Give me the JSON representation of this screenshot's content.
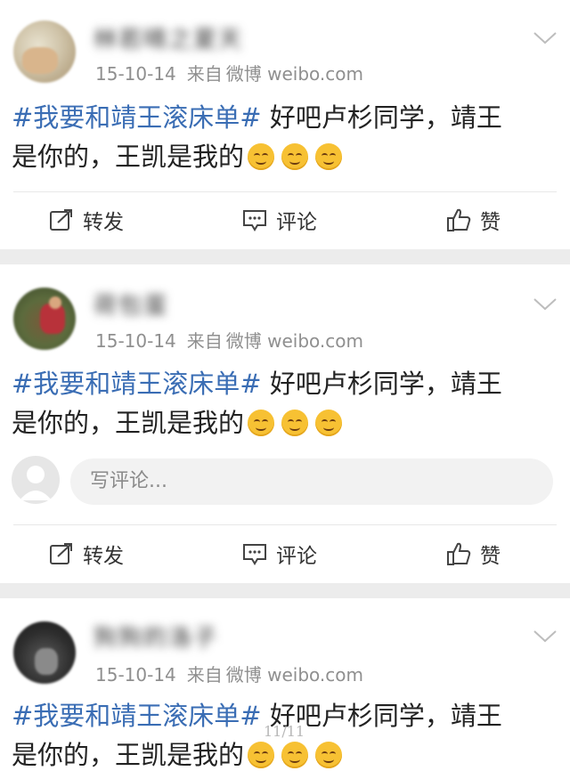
{
  "posts": [
    {
      "username": "林若晴之夏天",
      "date": "15-10-14",
      "source_prefix": "来自",
      "source": "微博 weibo.com",
      "topic": "#我要和靖王滚床单#",
      "text_line1": " 好吧卢杉同学，靖王",
      "text_line2": "是你的，王凯是我的",
      "emoji": "smile-emoji",
      "repost_label": "转发",
      "comment_label": "评论",
      "like_label": "赞"
    },
    {
      "username": "荷包蛋",
      "date": "15-10-14",
      "source_prefix": "来自",
      "source": "微博 weibo.com",
      "topic": "#我要和靖王滚床单#",
      "text_line1": " 好吧卢杉同学，靖王",
      "text_line2": "是你的，王凯是我的",
      "comment_placeholder": "写评论...",
      "repost_label": "转发",
      "comment_label": "评论",
      "like_label": "赞"
    },
    {
      "username": "狗狗的洛子",
      "date": "15-10-14",
      "source_prefix": "来自",
      "source": "微博 weibo.com",
      "topic": "#我要和靖王滚床单#",
      "text_line1": " 好吧卢杉同学，靖王",
      "text_line2": "是你的，王凯是我的"
    }
  ],
  "pager": "11/11",
  "colors": {
    "topic": "#3a6db4",
    "meta": "#8f8f8f",
    "separator": "#ececec"
  },
  "icons": {
    "repost": "repost-icon",
    "comment": "comment-icon",
    "like": "thumbs-up-icon",
    "more": "chevron-down-icon"
  }
}
